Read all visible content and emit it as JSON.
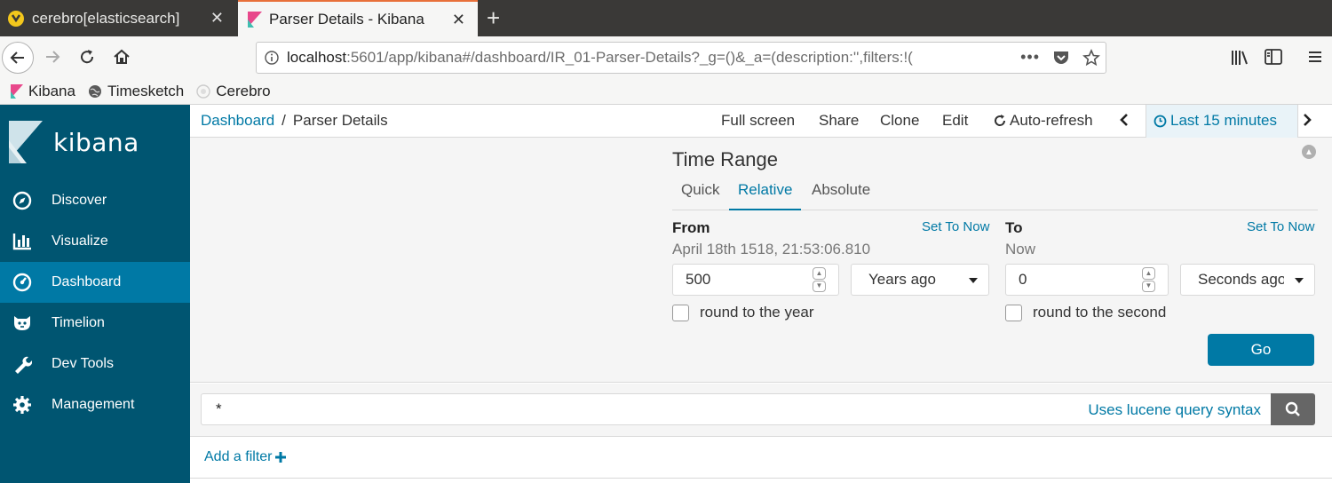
{
  "browser": {
    "tabs": [
      {
        "title": "cerebro[elasticsearch]",
        "active": false
      },
      {
        "title": "Parser Details - Kibana",
        "active": true
      }
    ],
    "url": {
      "host": "localhost",
      "path": ":5601/app/kibana#/dashboard/IR_01-Parser-Details?_g=()&_a=(description:'',filters:!("
    },
    "bookmarks": [
      "Kibana",
      "Timesketch",
      "Cerebro"
    ]
  },
  "kibana": {
    "logo_text": "kibana",
    "menu": [
      {
        "label": "Discover",
        "icon": "compass-icon"
      },
      {
        "label": "Visualize",
        "icon": "bar-chart-icon"
      },
      {
        "label": "Dashboard",
        "icon": "dashboard-icon",
        "active": true
      },
      {
        "label": "Timelion",
        "icon": "timelion-icon"
      },
      {
        "label": "Dev Tools",
        "icon": "wrench-icon"
      },
      {
        "label": "Management",
        "icon": "gear-icon"
      }
    ],
    "breadcrumb": {
      "root": "Dashboard",
      "separator": "/",
      "current": "Parser Details"
    },
    "top_menu": {
      "full_screen": "Full screen",
      "share": "Share",
      "clone": "Clone",
      "edit": "Edit",
      "auto_refresh": "Auto-refresh",
      "time_label": "Last 15 minutes"
    },
    "time_range": {
      "title": "Time Range",
      "tabs": [
        "Quick",
        "Relative",
        "Absolute"
      ],
      "active_tab": "Relative",
      "from": {
        "label": "From",
        "set_to_now": "Set To Now",
        "preview": "April 18th 1518, 21:53:06.810",
        "value": "500",
        "unit": "Years ago",
        "round_label": "round to the year"
      },
      "to": {
        "label": "To",
        "set_to_now": "Set To Now",
        "preview": "Now",
        "value": "0",
        "unit": "Seconds ago",
        "round_label": "round to the second"
      },
      "go_label": "Go"
    },
    "query": {
      "value": "*",
      "syntax_link": "Uses lucene query syntax"
    },
    "filter": {
      "add_label": "Add a filter"
    },
    "colors": {
      "sidebar": "#005571",
      "active": "#0079a5",
      "accent": "#0079a5"
    }
  }
}
